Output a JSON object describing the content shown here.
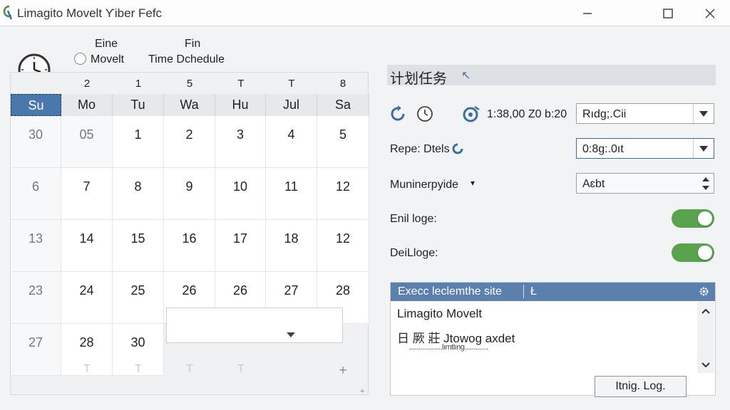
{
  "window": {
    "title": "Limagito Movelt Ƴiber Fefc"
  },
  "options": {
    "fine_label": "Eine",
    "fin_label": "Fin",
    "radio_label": "Movelt",
    "time_schedule_label": "Time Dchedule"
  },
  "calendar": {
    "column_numbers": [
      "2",
      "1",
      "5",
      "T",
      "T",
      "8"
    ],
    "day_headers": [
      "Su",
      "Mo",
      "Tu",
      "Wa",
      "Hu",
      "Jul",
      "Sa"
    ],
    "selected_day_index": 0,
    "weeks": [
      [
        "30",
        "05",
        "1",
        "2",
        "3",
        "4",
        "5"
      ],
      [
        "6",
        "7",
        "8",
        "9",
        "10",
        "11",
        "12"
      ],
      [
        "13",
        "14",
        "15",
        "16",
        "17",
        "18",
        "12"
      ],
      [
        "23",
        "24",
        "25",
        "26",
        "26",
        "27",
        "28"
      ],
      [
        "27",
        "28",
        "30",
        "",
        "",
        "",
        ""
      ]
    ],
    "ghost_row": [
      "T",
      "T",
      "T",
      "T",
      "",
      "",
      "+"
    ]
  },
  "schedule": {
    "title": "计划任务",
    "time_range": "1:38,00 Z0 b:20",
    "combo1_value": "Rıdg;.Cii",
    "repeat_label": "Repe: Dtels",
    "combo2_value": "0:8g:.0ıt",
    "mode_label": "Muninerpyide",
    "spinner_value": "Aɛbt",
    "toggle1_label": "Enil loge:",
    "toggle1_on": true,
    "toggle2_label": "DeiLloge:",
    "toggle2_on": true
  },
  "log": {
    "header_text": "Execc leclemthe site",
    "header_suffix": "Ł",
    "line1": "Limagito Movelt",
    "line2": "日 厥 莊 Jtowog axdet",
    "line3": "..................lımtlıng.............",
    "button_label": "Itnig. Log."
  },
  "colors": {
    "accent": "#4a78ac",
    "header_blue": "#5c80ad",
    "toggle_green": "#59a34e"
  }
}
